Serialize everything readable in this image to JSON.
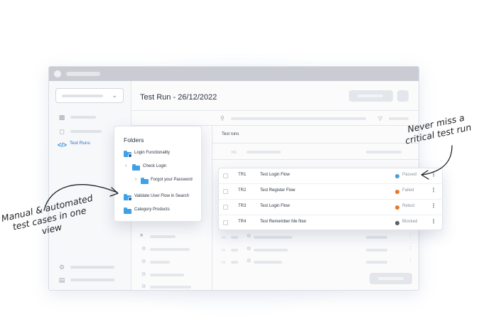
{
  "window": {
    "title": "Test Run - 26/12/2022"
  },
  "sidebar": {
    "active_item": {
      "label": "Test Runs",
      "icon": "code-brackets-icon"
    },
    "items": [
      {
        "icon": "bar-chart-icon"
      },
      {
        "icon": "folder-icon"
      },
      {
        "icon": "code-brackets-icon",
        "label": "Test Runs"
      },
      {
        "icon": "settings-icon"
      },
      {
        "icon": "clipboard-icon"
      }
    ]
  },
  "main": {
    "test_runs_header": "Test runs"
  },
  "folders_panel": {
    "title": "Folders",
    "items": [
      {
        "label": "Login Functionality",
        "icon": "folder-gear-icon"
      },
      {
        "label": "Check Login",
        "icon": "folder-icon"
      },
      {
        "label": "Forgot your Password",
        "icon": "folder-icon"
      },
      {
        "label": "Validate User Flow in Search",
        "icon": "folder-gear-icon"
      },
      {
        "label": "Category Products",
        "icon": "folder-icon"
      }
    ]
  },
  "test_runs": [
    {
      "id": "TR1",
      "title": "Test Login Flow",
      "status": "Passed",
      "status_color": "#4a9fd8"
    },
    {
      "id": "TR2",
      "title": "Test Register Flow",
      "status": "Failed",
      "status_color": "#e8782a"
    },
    {
      "id": "TR3",
      "title": "Test Login Flow",
      "status": "Retest",
      "status_color": "#e8782a"
    },
    {
      "id": "TR4",
      "title": "Test Remember Me flow",
      "status": "Blocked",
      "status_color": "#5b6068"
    }
  ],
  "annotations": {
    "left": "Manual & automated test cases in one view",
    "right": "Never miss a critical test run"
  },
  "colors": {
    "accent": "#2e89d8",
    "folder": "#3fa0e4"
  }
}
